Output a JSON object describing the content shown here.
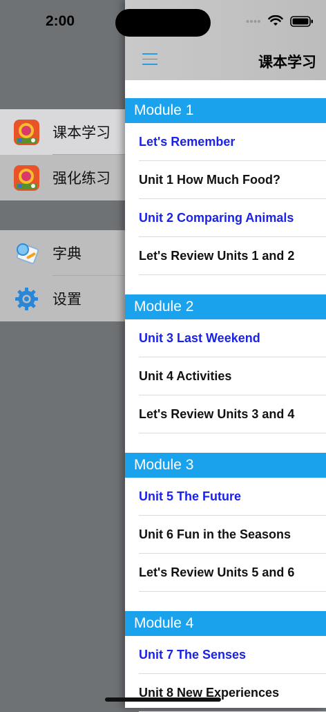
{
  "status_bar": {
    "time": "2:00"
  },
  "drawer": {
    "items": [
      {
        "label": "课本学习",
        "icon": "textbook-app-icon",
        "selected": true
      },
      {
        "label": "强化练习",
        "icon": "practice-app-icon",
        "selected": false
      },
      {
        "label": "字典",
        "icon": "dictionary-icon",
        "selected": false
      },
      {
        "label": "设置",
        "icon": "gear-icon",
        "selected": false
      }
    ]
  },
  "navbar": {
    "title": "课本学习",
    "menu_icon": "hamburger-icon"
  },
  "modules": [
    {
      "title": "Module 1",
      "lessons": [
        {
          "title": "Let's Remember",
          "color": "blue"
        },
        {
          "title": "Unit 1 How Much Food?",
          "color": "black"
        },
        {
          "title": "Unit 2 Comparing Animals",
          "color": "blue"
        },
        {
          "title": "Let's Review Units 1 and 2",
          "color": "black"
        }
      ]
    },
    {
      "title": "Module 2",
      "lessons": [
        {
          "title": "Unit 3 Last Weekend",
          "color": "blue"
        },
        {
          "title": "Unit 4 Activities",
          "color": "black"
        },
        {
          "title": "Let's Review Units 3 and 4",
          "color": "black"
        }
      ]
    },
    {
      "title": "Module 3",
      "lessons": [
        {
          "title": "Unit 5 The Future",
          "color": "blue"
        },
        {
          "title": "Unit 6 Fun in the Seasons",
          "color": "black"
        },
        {
          "title": "Let's Review Units 5 and 6",
          "color": "black"
        }
      ]
    },
    {
      "title": "Module 4",
      "lessons": [
        {
          "title": "Unit 7 The Senses",
          "color": "blue"
        },
        {
          "title": "Unit 8 New Experiences",
          "color": "black"
        }
      ]
    }
  ],
  "colors": {
    "accent": "#1aa3ec",
    "link_blue": "#1a22e8"
  }
}
